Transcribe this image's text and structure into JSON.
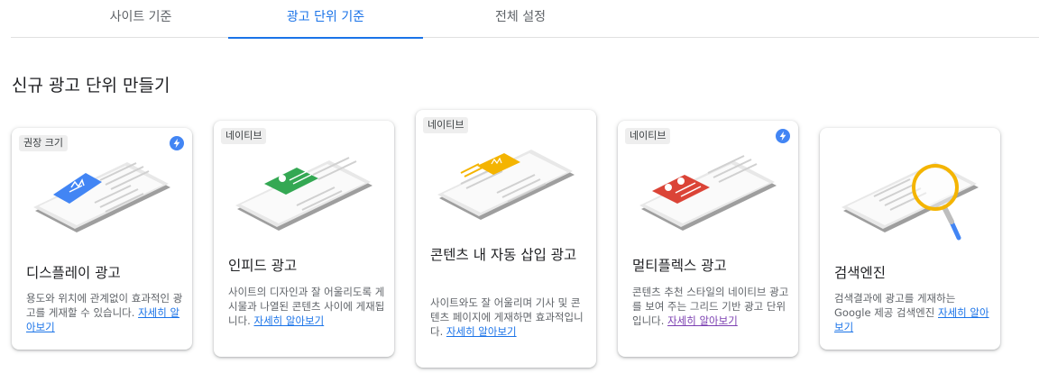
{
  "tabs": [
    {
      "label": "사이트 기준",
      "active": false
    },
    {
      "label": "광고 단위 기준",
      "active": true
    },
    {
      "label": "전체 설정",
      "active": false
    }
  ],
  "section_title": "신규 광고 단위 만들기",
  "cards": [
    {
      "badge": "권장 크기",
      "has_bolt_icon": true,
      "illustration": "display-ad-illustration",
      "illustration_color": "#4285f4",
      "title": "디스플레이 광고",
      "description": "용도와 위치에 관계없이 효과적인 광고를 게재할 수 있습니다.",
      "link": "자세히 알아보기"
    },
    {
      "badge": "네이티브",
      "has_bolt_icon": false,
      "illustration": "infeed-ad-illustration",
      "illustration_color": "#34a853",
      "title": "인피드 광고",
      "description": "사이트의 디자인과 잘 어울리도록 게시물과 나열된 콘텐츠 사이에 게재됩니다.",
      "link": "자세히 알아보기"
    },
    {
      "badge": "네이티브",
      "has_bolt_icon": false,
      "illustration": "in-article-ad-illustration",
      "illustration_color": "#f4b400",
      "title": "콘텐츠 내 자동 삽입 광고",
      "description": "사이트와도 잘 어울리며 기사 및 콘텐츠 페이지에 게재하면 효과적입니다.",
      "link": "자세히 알아보기"
    },
    {
      "badge": "네이티브",
      "has_bolt_icon": true,
      "illustration": "multiplex-ad-illustration",
      "illustration_color": "#db4437",
      "title": "멀티플렉스 광고",
      "description": "콘텐츠 추천 스타일의 네이티브 광고를 보여 주는 그리드 기반 광고 단위입니다.",
      "link": "자세히 알아보기"
    },
    {
      "badge": "",
      "has_bolt_icon": false,
      "illustration": "search-engine-illustration",
      "illustration_color": "#f4b400",
      "title": "검색엔진",
      "description": "검색결과에 광고를 게재하는 Google 제공 검색엔진",
      "link": "자세히 알아보기"
    }
  ],
  "colors": {
    "accent": "#1a73e8",
    "visited_link": "#7b3fb1"
  }
}
